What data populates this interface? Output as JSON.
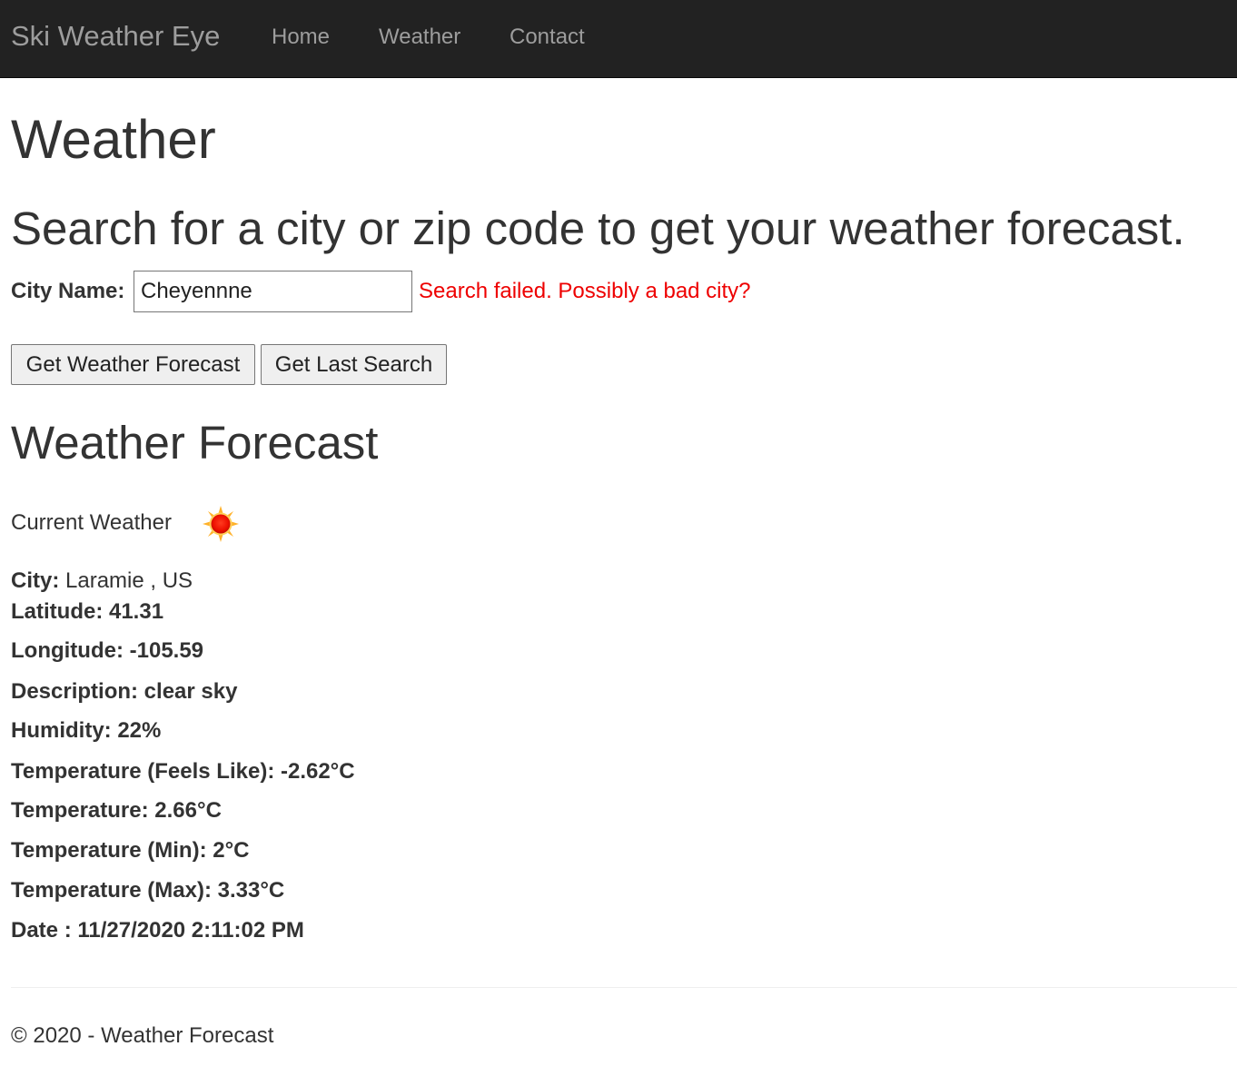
{
  "nav": {
    "brand": "Ski Weather Eye",
    "links": [
      "Home",
      "Weather",
      "Contact"
    ]
  },
  "page": {
    "title": "Weather",
    "subtitle": "Search for a city or zip code to get your weather forecast."
  },
  "search": {
    "label": "City Name:",
    "value": "Cheyennne",
    "error": "Search failed. Possibly a bad city?",
    "forecast_button": "Get Weather Forecast",
    "last_search_button": "Get Last Search"
  },
  "forecast": {
    "title": "Weather Forecast",
    "current_label": "Current Weather",
    "icon": "sun-icon",
    "city_label": "City:",
    "city_value": "Laramie , US",
    "latitude": "Latitude: 41.31",
    "longitude": "Longitude: -105.59",
    "description": "Description: clear sky",
    "humidity": "Humidity: 22%",
    "feels_like": "Temperature (Feels Like): -2.62°C",
    "temperature": "Temperature: 2.66°C",
    "temp_min": "Temperature (Min): 2°C",
    "temp_max": "Temperature (Max): 3.33°C",
    "date": "Date : 11/27/2020 2:11:02 PM"
  },
  "footer": {
    "text": "© 2020 - Weather Forecast"
  },
  "colors": {
    "navbar_bg": "#222222",
    "nav_text": "#9d9d9d",
    "error": "#ee0000",
    "text": "#333333"
  }
}
